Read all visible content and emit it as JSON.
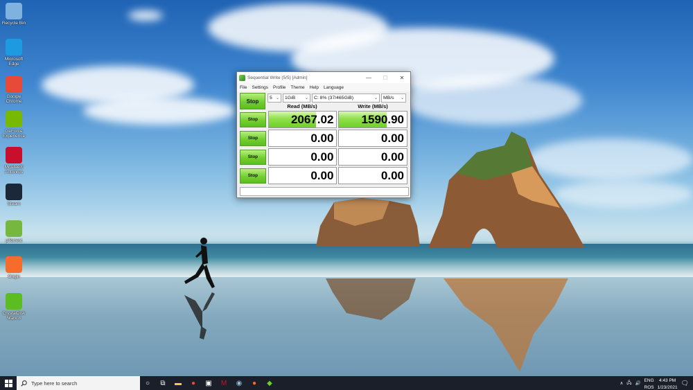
{
  "desktop": {
    "icons": [
      {
        "label": "Recycle Bin",
        "icon": "recycle-bin-icon",
        "color": "#7fb2de"
      },
      {
        "label": "Microsoft Edge",
        "icon": "edge-icon",
        "color": "#1e9be0"
      },
      {
        "label": "Google Chrome",
        "icon": "chrome-icon",
        "color": "#e84a3a"
      },
      {
        "label": "GeForce Experience",
        "icon": "nvidia-icon",
        "color": "#76b900"
      },
      {
        "label": "McAfee® AntiVirus",
        "icon": "mcafee-icon",
        "color": "#c8102e"
      },
      {
        "label": "Steam",
        "icon": "steam-icon",
        "color": "#1b2838"
      },
      {
        "label": "µTorrent",
        "icon": "utorrent-icon",
        "color": "#76b83f"
      },
      {
        "label": "Origin",
        "icon": "origin-icon",
        "color": "#f56c2d"
      },
      {
        "label": "CrystalDiskMark 8",
        "icon": "crystaldiskmark-icon",
        "color": "#5cbd22"
      }
    ]
  },
  "window": {
    "title": "Sequential Write (5/5) [Admin]",
    "controls": {
      "minimize": "—",
      "maximize": "☐",
      "close": "✕"
    },
    "menu": [
      "File",
      "Settings",
      "Profile",
      "Theme",
      "Help",
      "Language"
    ],
    "main_button": "Stop",
    "settings": {
      "count": "5",
      "size": "1GiB",
      "drive": "C: 8% (37/465GiB)",
      "unit": "MB/s"
    },
    "headers": {
      "read": "Read (MB/s)",
      "write": "Write (MB/s)"
    },
    "rows": [
      {
        "button": "Stop",
        "read": "2067.02",
        "write": "1590.90",
        "read_fill": 0.7,
        "write_fill": 0.7
      },
      {
        "button": "Stop",
        "read": "0.00",
        "write": "0.00",
        "read_fill": 0,
        "write_fill": 0
      },
      {
        "button": "Stop",
        "read": "0.00",
        "write": "0.00",
        "read_fill": 0,
        "write_fill": 0
      },
      {
        "button": "Stop",
        "read": "0.00",
        "write": "0.00",
        "read_fill": 0,
        "write_fill": 0
      }
    ]
  },
  "taskbar": {
    "search_placeholder": "Type here to search",
    "pinned": [
      "task-view-icon",
      "file-explorer-icon",
      "chrome-icon",
      "store-icon",
      "mcafee-icon",
      "steam-icon",
      "origin-icon",
      "crystaldiskmark-icon"
    ],
    "lang_top": "ENG",
    "lang_bottom": "ROS",
    "time": "4:43 PM",
    "date": "1/23/2021"
  }
}
